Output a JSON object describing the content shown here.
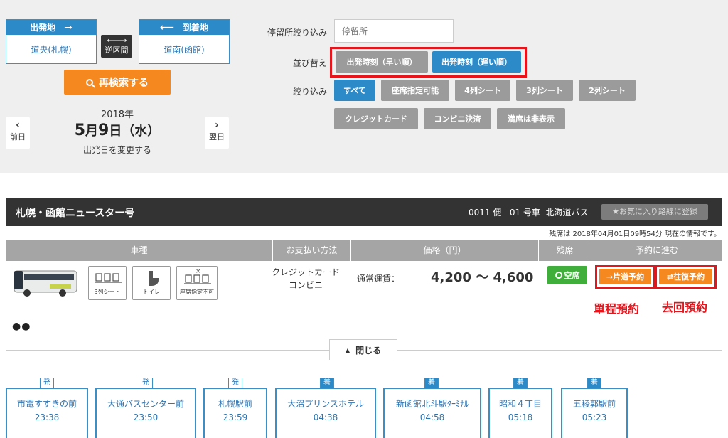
{
  "search": {
    "departure": {
      "label": "出発地",
      "value": "道央(札幌)"
    },
    "arrival": {
      "label": "到着地",
      "value": "道南(函館)"
    },
    "swap_label": "逆区間",
    "research_label": "再検索する",
    "prev_day": "前日",
    "next_day": "翌日",
    "year": "2018年",
    "month": "5",
    "month_unit": "月",
    "day": "9",
    "day_unit": "日",
    "weekday": "（水）",
    "change_date": "出発日を変更する"
  },
  "filters": {
    "stop_label": "停留所絞り込み",
    "stop_placeholder": "停留所",
    "sort_label": "並び替え",
    "sort_options": [
      "出発時刻（早い順）",
      "出発時刻（遅い順）"
    ],
    "filter_label": "絞り込み",
    "filter_options": [
      "すべて",
      "座席指定可能",
      "4列シート",
      "3列シート",
      "2列シート",
      "クレジットカード",
      "コンビニ決済",
      "満席は非表示"
    ]
  },
  "route": {
    "name": "札幌・函館ニュースター号",
    "flight_no": "0011 便",
    "car_no": "01 号車",
    "operator": "北海道バス",
    "fav_button": "★お気に入り路線に登録",
    "info_note": "残席は 2018年04月01日09時54分 現在の情報です。"
  },
  "table": {
    "headers": [
      "車種",
      "お支払い方法",
      "価格（円）",
      "残席",
      "予約に進む"
    ],
    "features": [
      "3列シート",
      "トイレ",
      "座席指定不可"
    ],
    "payment": [
      "クレジットカード",
      "コンビニ"
    ],
    "fare_label": "通常運賃：",
    "fare_value": "4,200 ～ 4,600",
    "seat_status": "空席",
    "oneway_button": "片道予約",
    "roundtrip_button": "往復予約",
    "oneway_note": "單程預約",
    "roundtrip_note": "去回預約",
    "dots": "●●",
    "close_label": "閉じる"
  },
  "stops": [
    {
      "tag": "発",
      "name": "市電すすきの前",
      "time": "23:38"
    },
    {
      "tag": "発",
      "name": "大通バスセンター前",
      "time": "23:50"
    },
    {
      "tag": "発",
      "name": "札幌駅前",
      "time": "23:59"
    },
    {
      "tag": "着",
      "name": "大沼プリンスホテル",
      "time": "04:38"
    },
    {
      "tag": "着",
      "name": "新函館北斗駅ﾀｰﾐﾅﾙ",
      "time": "04:58"
    },
    {
      "tag": "着",
      "name": "昭和４丁目",
      "time": "05:18"
    },
    {
      "tag": "着",
      "name": "五稜郭駅前",
      "time": "05:23"
    }
  ],
  "colors": {
    "accent_blue": "#2d8ac9",
    "orange": "#f5891f",
    "highlight_red": "#e8141c",
    "available_green": "#3fae3a"
  }
}
